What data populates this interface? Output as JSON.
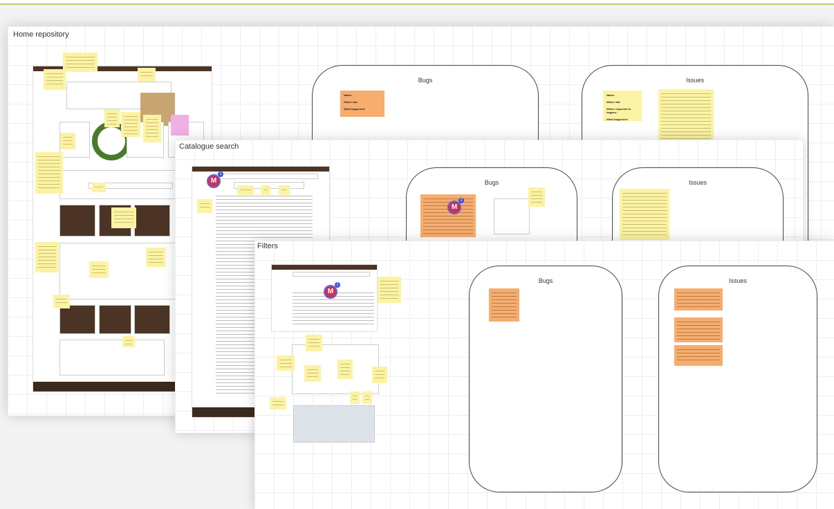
{
  "boards": {
    "home": {
      "title": "Home repository"
    },
    "catalogue": {
      "title": "Catalogue search"
    },
    "filters": {
      "title": "Filters"
    }
  },
  "frames": {
    "home_bugs": "Bugs",
    "home_issues": "Issues",
    "cat_bugs": "Bugs",
    "cat_issues": "Issues",
    "fil_bugs": "Bugs",
    "fil_issues": "Issues"
  },
  "home_bug_note": "Name:\n\nWhat I did:\n\nWhat happened:",
  "home_issue_note": "Name:\n\nWhat I did:\n\nWhat I expected to happen:\n\nWhat happened:",
  "markers": {
    "letter": "M",
    "count": "1"
  },
  "colors": {
    "sticky_yellow": "#fbf3a3",
    "sticky_orange": "#f6ad6e",
    "site_brown": "#4b3425",
    "marker": "#c9315a"
  }
}
